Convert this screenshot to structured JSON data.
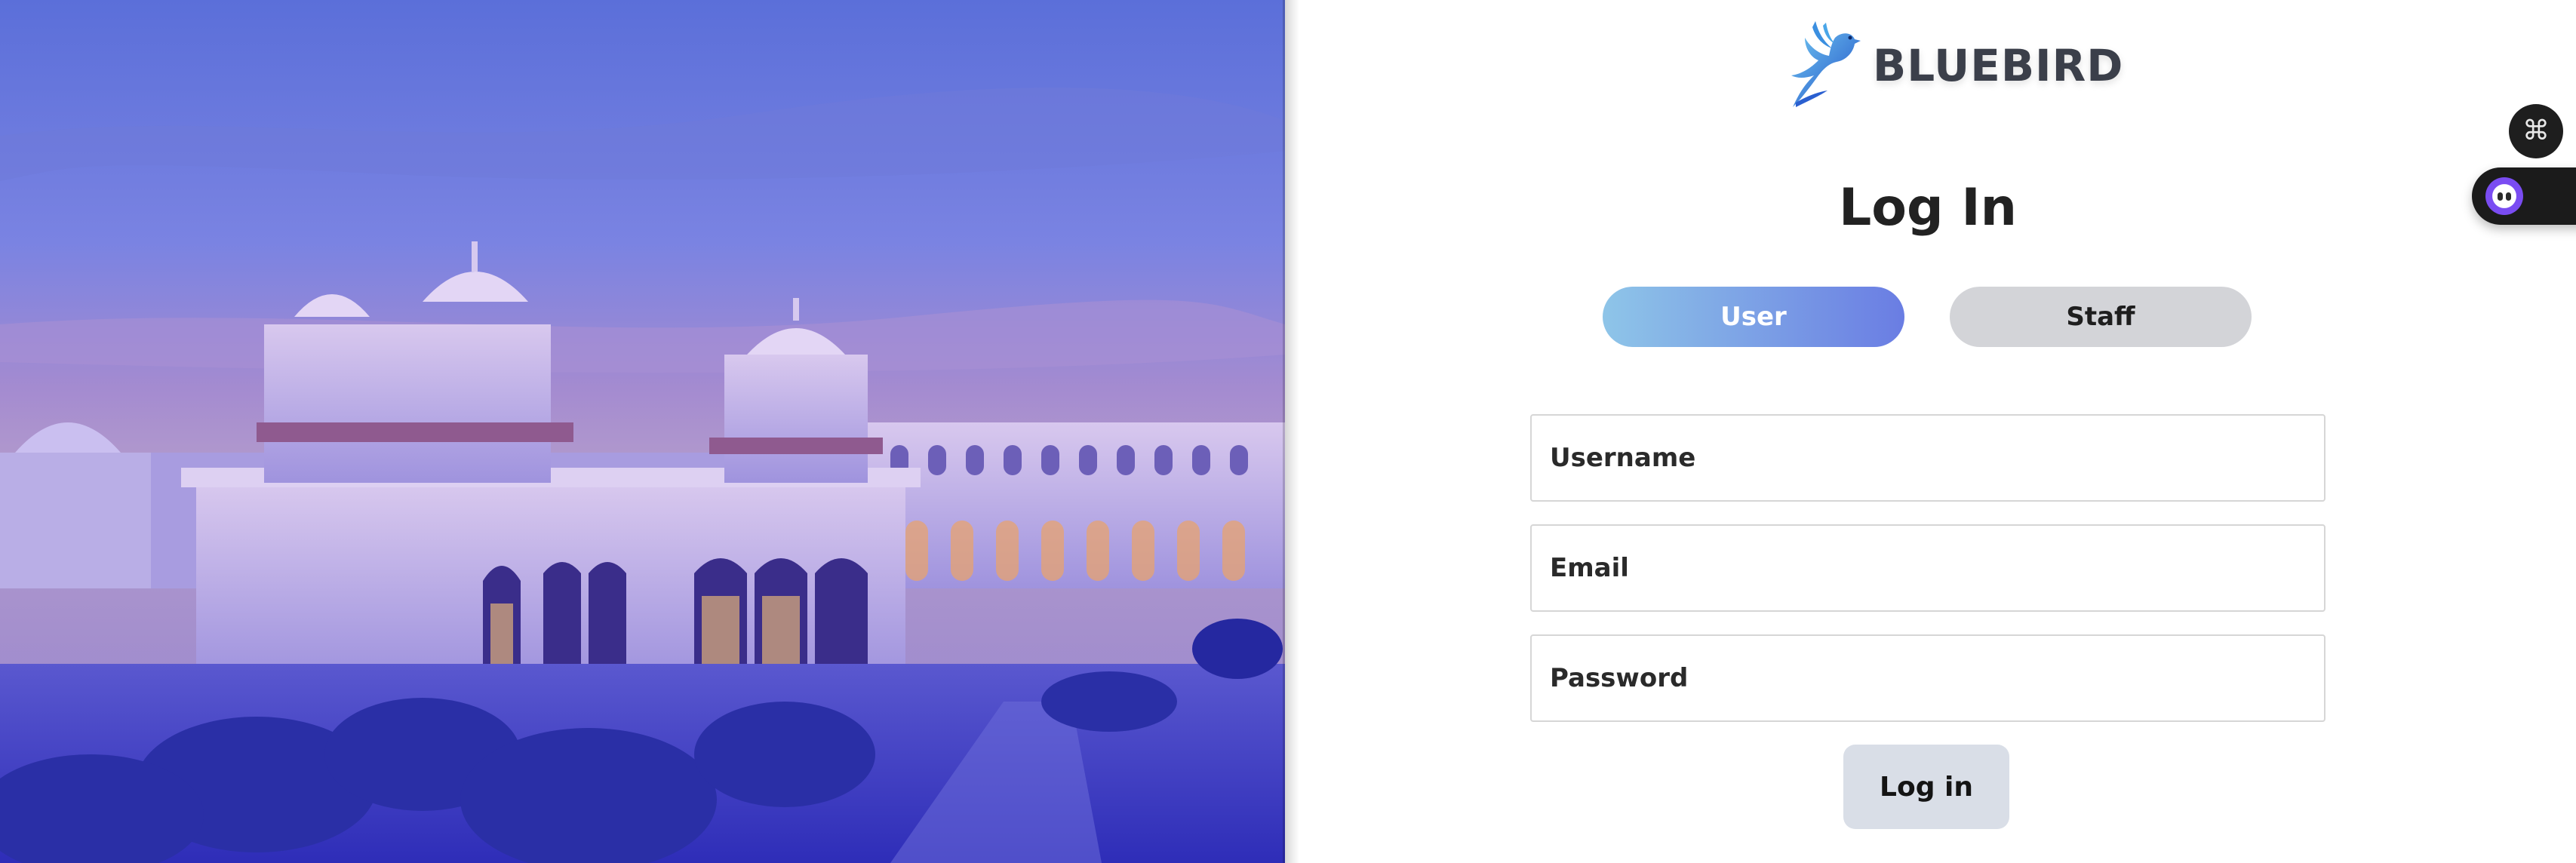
{
  "brand": {
    "name": "BLUEBIRD",
    "logo_icon": "bluebird-logo-icon"
  },
  "login": {
    "title": "Log In",
    "role_tabs": [
      {
        "label": "User",
        "active": true
      },
      {
        "label": "Staff",
        "active": false
      }
    ],
    "fields": {
      "username_placeholder": "Username",
      "email_placeholder": "Email",
      "password_placeholder": "Password"
    },
    "submit_label": "Log in"
  },
  "hero": {
    "image": "palace-at-dusk-photo"
  },
  "floating_widgets": {
    "command_icon": "command-key-icon",
    "command_glyph": "⌘",
    "assistant_icon": "assistant-bot-icon"
  },
  "colors": {
    "accent_gradient_start": "#8ec5e8",
    "accent_gradient_end": "#6a7de3",
    "inactive_tab": "#d3d4d8",
    "login_button": "#d9dee7",
    "hero_tint": "#4a4ad6"
  }
}
